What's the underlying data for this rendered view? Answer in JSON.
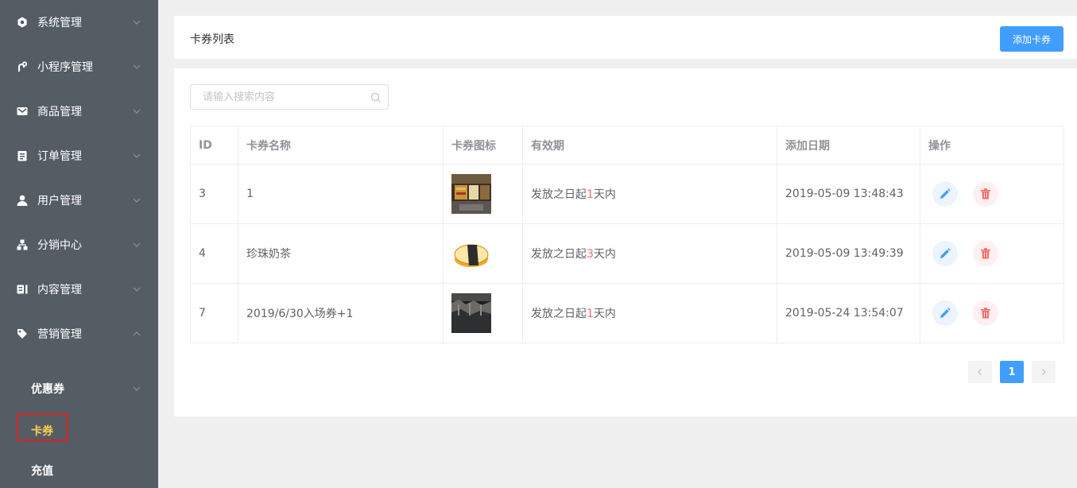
{
  "sidebar": {
    "items": [
      {
        "label": "系统管理",
        "icon": "gear-icon"
      },
      {
        "label": "小程序管理",
        "icon": "link-icon"
      },
      {
        "label": "商品管理",
        "icon": "envelope-icon"
      },
      {
        "label": "订单管理",
        "icon": "clipboard-icon"
      },
      {
        "label": "用户管理",
        "icon": "user-icon"
      },
      {
        "label": "分销中心",
        "icon": "sitemap-icon"
      },
      {
        "label": "内容管理",
        "icon": "content-icon"
      },
      {
        "label": "营销管理",
        "icon": "tag-icon"
      }
    ],
    "sub_items": [
      {
        "label": "优惠券"
      },
      {
        "label": "卡券"
      },
      {
        "label": "充值"
      }
    ],
    "active_color": "#ffd04b"
  },
  "header": {
    "title": "卡券列表",
    "add_button": "添加卡券"
  },
  "search": {
    "placeholder": "请输入搜索内容"
  },
  "table": {
    "columns": [
      "ID",
      "卡券名称",
      "卡券图标",
      "有效期",
      "添加日期",
      "操作"
    ],
    "rows": [
      {
        "id": "3",
        "name": "1",
        "icon": "store-photo",
        "validity_pre": "发放之日起",
        "validity_num": "1",
        "validity_post": "天内",
        "date": "2019-05-09 13:48:43"
      },
      {
        "id": "4",
        "name": "珍珠奶茶",
        "icon": "sushi-image",
        "validity_pre": "发放之日起",
        "validity_num": "3",
        "validity_post": "天内",
        "date": "2019-05-09 13:49:39"
      },
      {
        "id": "7",
        "name": "2019/6/30入场券+1",
        "icon": "dark-scene-photo",
        "validity_pre": "发放之日起",
        "validity_num": "1",
        "validity_post": "天内",
        "date": "2019-05-24 13:54:07"
      }
    ]
  },
  "pagination": {
    "current": "1"
  },
  "colors": {
    "sidebar_bg": "#545c64",
    "primary": "#409eff",
    "danger": "#f56c6c"
  }
}
